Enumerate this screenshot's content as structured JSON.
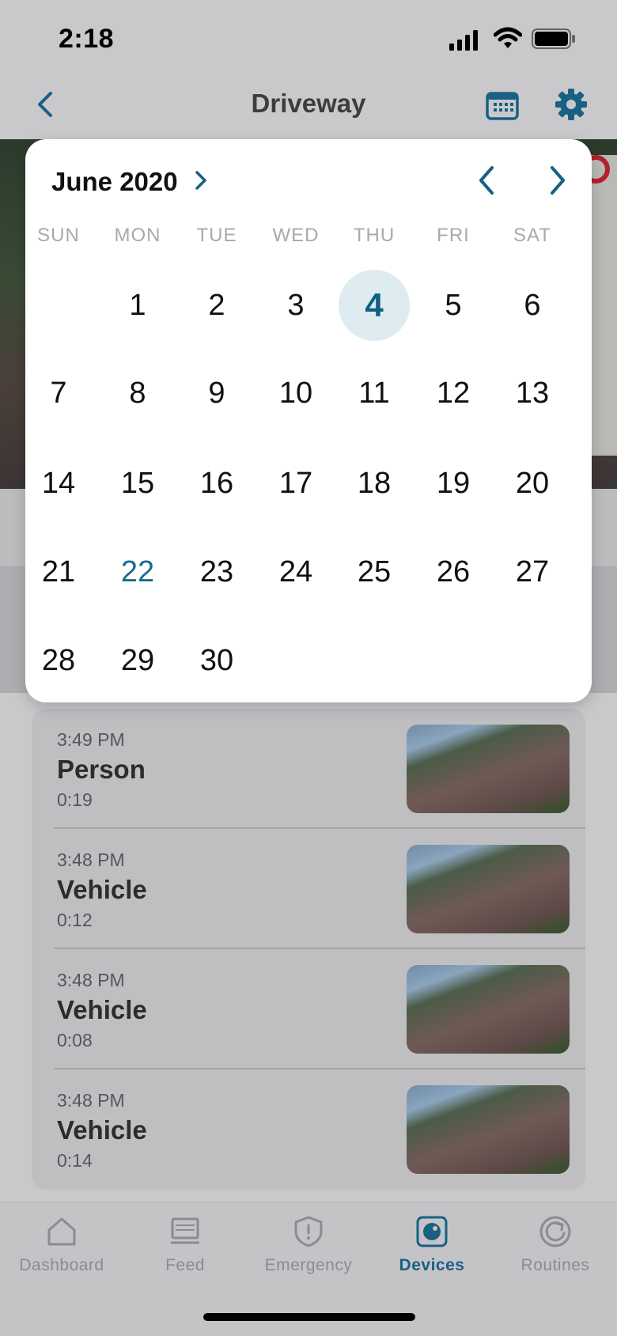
{
  "status_bar": {
    "time": "2:18"
  },
  "nav": {
    "title": "Driveway"
  },
  "calendar": {
    "month_label": "June 2020",
    "weekdays": [
      "SUN",
      "MON",
      "TUE",
      "WED",
      "THU",
      "FRI",
      "SAT"
    ],
    "days": [
      "1",
      "2",
      "3",
      "4",
      "5",
      "6",
      "7",
      "8",
      "9",
      "10",
      "11",
      "12",
      "13",
      "14",
      "15",
      "16",
      "17",
      "18",
      "19",
      "20",
      "21",
      "22",
      "23",
      "24",
      "25",
      "26",
      "27",
      "28",
      "29",
      "30"
    ],
    "first_weekday_index": 1,
    "selected_day": "4",
    "highlighted_day": "22"
  },
  "events": [
    {
      "time": "3:49 PM",
      "type": "Person",
      "duration": "0:19"
    },
    {
      "time": "3:48 PM",
      "type": "Vehicle",
      "duration": "0:12"
    },
    {
      "time": "3:48 PM",
      "type": "Vehicle",
      "duration": "0:08"
    },
    {
      "time": "3:48 PM",
      "type": "Vehicle",
      "duration": "0:14"
    }
  ],
  "tabs": [
    {
      "label": "Dashboard",
      "icon": "home-icon",
      "active": false
    },
    {
      "label": "Feed",
      "icon": "monitor-icon",
      "active": false
    },
    {
      "label": "Emergency",
      "icon": "shield-icon",
      "active": false
    },
    {
      "label": "Devices",
      "icon": "camera-icon",
      "active": true
    },
    {
      "label": "Routines",
      "icon": "refresh-icon",
      "active": false
    }
  ],
  "colors": {
    "accent": "#1a5f84",
    "selected_bg": "#deebf0",
    "record": "#b41f2b"
  }
}
